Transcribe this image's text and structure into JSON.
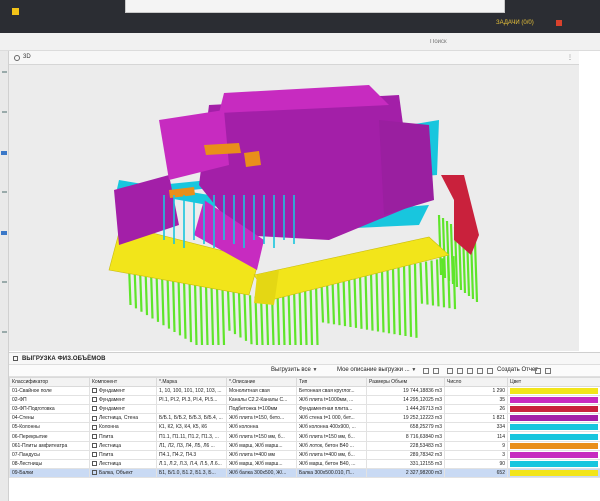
{
  "window": {
    "tab_text": "ЗАДАЧИ (0/0)",
    "search_placeholder": "Поиск"
  },
  "view3d": {
    "tab_label": "3D",
    "colors": {
      "purple": "#a31fa8",
      "magenta": "#c72bc0",
      "cyan": "#18c6de",
      "yellow": "#f2e51a",
      "green": "#5fe52a",
      "orange": "#e98f1a",
      "red": "#c9213c",
      "background": "#ececec"
    }
  },
  "bottom": {
    "title": "ВЫГРУЗКА ФИЗ.ОБЪЁМОВ",
    "toolbar": {
      "export_all": "Выгрузить все",
      "my_descriptions": "Мое описание выгрузки ...",
      "create_report": "Создать Отчет"
    },
    "columns": [
      "Классификатор",
      "Компонент",
      "*.Марка",
      "*.Описание",
      "Тип",
      "Размеры Объем",
      "Число",
      "Цвет"
    ],
    "rows": [
      {
        "classifier": "01-Свайное поле",
        "component": "Фундамент",
        "mark": "1, 10, 100, 101, 102, 103, ...",
        "description": "Монолитная свая",
        "type": "Бетонная свая круглог...",
        "volume": "19 744,18836 m3",
        "count": "1 290",
        "color": "#f2e51a"
      },
      {
        "classifier": "02-ФП",
        "component": "Фундамент",
        "mark": "Рl.1, Рl.2, Рl.3, Рl.4, Рl.5...",
        "description": "Каналы С2.2-Каналы С...",
        "type": "Ж/б плита t=1000мм, ...",
        "volume": "14 295,12025 m3",
        "count": "35",
        "color": "#c72bc0"
      },
      {
        "classifier": "03-ФП-Подготовка",
        "component": "Фундамент",
        "mark": "",
        "description": "Подбетонка t=100мм",
        "type": "Фундаментная плита...",
        "volume": "1 444,26713 m3",
        "count": "26",
        "color": "#c9213c"
      },
      {
        "classifier": "04-Стены",
        "component": "Лестница, Стена",
        "mark": "Б/Б.1, Б/Б.2, Б/Б.3, Б/Б.4, ...",
        "description": "Ж/б плита t=150, бето...",
        "type": "Ж/б стена t=1 000, бет...",
        "volume": "19 252,12223 m3",
        "count": "1 821",
        "color": "#a31fa8"
      },
      {
        "classifier": "05-Колонны",
        "component": "Колонна",
        "mark": "К1, К2, К3, К4, К5, К6",
        "description": "Ж/б колонна",
        "type": "Ж/б колонна 400x900, ...",
        "volume": "658,25279 m3",
        "count": "334",
        "color": "#18c6de"
      },
      {
        "classifier": "06-Перекрытие",
        "component": "Плита",
        "mark": "П1.1, П1.11, П1.2, П1.3, ...",
        "description": "Ж/б плита t=150 мм, б...",
        "type": "Ж/б плита t=150 мм, б...",
        "volume": "8 716,63840 m3",
        "count": "114",
        "color": "#18c6de"
      },
      {
        "classifier": "061-Плиты амфитеатра",
        "component": "Лестница",
        "mark": "Л1, Л2, Л3, Л4, Л5, Л6 ...",
        "description": "Ж/б марш, Ж/б марш...",
        "type": "Ж/б лоток, бетон В40 ...",
        "volume": "228,53483 m3",
        "count": "9",
        "color": "#e98f1a"
      },
      {
        "classifier": "07-Пандусы",
        "component": "Плита",
        "mark": "П4.1, П4.2, П4.3",
        "description": "Ж/б плита t=400 мм",
        "type": "Ж/б плита t=400 мм, б...",
        "volume": "289,78342 m3",
        "count": "3",
        "color": "#c72bc0"
      },
      {
        "classifier": "08-Лестницы",
        "component": "Лестница",
        "mark": "Л.1, Л.2, Л.3, Л.4, Л.5, Л.6...",
        "description": "Ж/б марш, Ж/б марш...",
        "type": "Ж/б марш, бетон В40, ...",
        "volume": "331,12155 m3",
        "count": "90",
        "color": "#18c6de"
      },
      {
        "classifier": "09-Балки",
        "component": "Балка, Объект",
        "mark": "Б1, Б/1.0, Б1.2, Б1.3, Б...",
        "description": "Ж/б балка 300x500, Ж/...",
        "type": "Балка 300x500.010, П...",
        "volume": "2 327,98200 m3",
        "count": "652",
        "color": "#f2e51a"
      }
    ]
  }
}
